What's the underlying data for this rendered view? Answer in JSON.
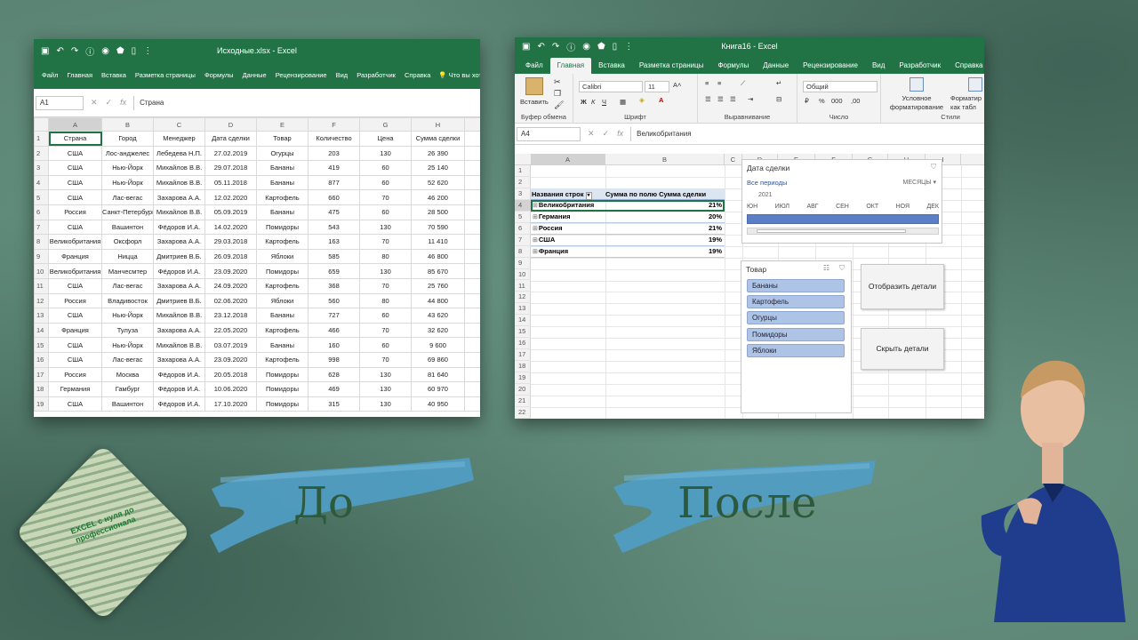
{
  "left_window": {
    "title": "Исходные.xlsx - Excel",
    "menu": [
      "Файл",
      "Главная",
      "Вставка",
      "Разметка страницы",
      "Формулы",
      "Данные",
      "Рецензирование",
      "Вид",
      "Разработчик",
      "Справка"
    ],
    "tell_me": "Что вы хотите сделать?",
    "name_box": "A1",
    "formula": "Страна",
    "columns": [
      "A",
      "B",
      "C",
      "D",
      "E",
      "F",
      "G",
      "H"
    ],
    "rows": [
      [
        "Страна",
        "Город",
        "Менеджер",
        "Дата сделки",
        "Товар",
        "Количество",
        "Цена",
        "Сумма сделки"
      ],
      [
        "США",
        "Лос-анджелес",
        "Лебедева Н.П.",
        "27.02.2019",
        "Огурцы",
        "203",
        "130",
        "26 390"
      ],
      [
        "США",
        "Нью-Йорк",
        "Михайлов В.В.",
        "29.07.2018",
        "Бананы",
        "419",
        "60",
        "25 140"
      ],
      [
        "США",
        "Нью-Йорк",
        "Михайлов В.В.",
        "05.11.2018",
        "Бананы",
        "877",
        "60",
        "52 620"
      ],
      [
        "США",
        "Лас-вегас",
        "Захарова А.А.",
        "12.02.2020",
        "Картофель",
        "660",
        "70",
        "46 200"
      ],
      [
        "Россия",
        "Санкт-Петербург",
        "Михайлов В.В.",
        "05.09.2019",
        "Бананы",
        "475",
        "60",
        "28 500"
      ],
      [
        "США",
        "Вашинтон",
        "Фёдоров И.А.",
        "14.02.2020",
        "Помидоры",
        "543",
        "130",
        "70 590"
      ],
      [
        "Великобритания",
        "Оксфорл",
        "Захарова А.А.",
        "29.03.2018",
        "Картофель",
        "163",
        "70",
        "11 410"
      ],
      [
        "Франция",
        "Ницца",
        "Дмитриев В.Б.",
        "26.09.2018",
        "Яблоки",
        "585",
        "80",
        "46 800"
      ],
      [
        "Великобритания",
        "Манчесмтер",
        "Фёдоров И.А.",
        "23.09.2020",
        "Помидоры",
        "659",
        "130",
        "85 670"
      ],
      [
        "США",
        "Лас-вегас",
        "Захарова А.А.",
        "24.09.2020",
        "Картофель",
        "368",
        "70",
        "25 760"
      ],
      [
        "Россия",
        "Владивосток",
        "Дмитриев В.Б.",
        "02.06.2020",
        "Яблоки",
        "560",
        "80",
        "44 800"
      ],
      [
        "США",
        "Нью-Йорк",
        "Михайлов В.В.",
        "23.12.2018",
        "Бананы",
        "727",
        "60",
        "43 620"
      ],
      [
        "Франция",
        "Тулуза",
        "Захарова А.А.",
        "22.05.2020",
        "Картофель",
        "466",
        "70",
        "32 620"
      ],
      [
        "США",
        "Нью-Йорк",
        "Михайлов В.В.",
        "03.07.2019",
        "Бананы",
        "160",
        "60",
        "9 600"
      ],
      [
        "США",
        "Лас-вегас",
        "Захарова А.А.",
        "23.09.2020",
        "Картофель",
        "998",
        "70",
        "69 860"
      ],
      [
        "Россия",
        "Москва",
        "Фёдоров И.А.",
        "20.05.2018",
        "Помидоры",
        "628",
        "130",
        "81 640"
      ],
      [
        "Германия",
        "Гамбург",
        "Фёдоров И.А.",
        "10.06.2020",
        "Помидоры",
        "469",
        "130",
        "60 970"
      ],
      [
        "США",
        "Вашинтон",
        "Фёдоров И.А.",
        "17.10.2020",
        "Помидоры",
        "315",
        "130",
        "40 950"
      ]
    ]
  },
  "right_window": {
    "title": "Книга16 - Excel",
    "menu": [
      "Файл",
      "Главная",
      "Вставка",
      "Разметка страницы",
      "Формулы",
      "Данные",
      "Рецензирование",
      "Вид",
      "Разработчик",
      "Справка"
    ],
    "active_tab": "Главная",
    "ribbon": {
      "paste": "Вставить",
      "clipboard": "Буфер обмена",
      "font_name": "Calibri",
      "font_size": "11",
      "font_group": "Шрифт",
      "align_group": "Выравнивание",
      "number_format": "Общий",
      "number_group": "Число",
      "cond_format": "Условное форматирование",
      "format_table": "Форматир как табл",
      "styles_group": "Стили"
    },
    "name_box": "A4",
    "formula": "Великобритания",
    "columns": [
      "A",
      "B",
      "C",
      "D",
      "E",
      "F",
      "G",
      "H",
      "I"
    ],
    "row_numbers": [
      "1",
      "2",
      "3",
      "4",
      "5",
      "6",
      "7",
      "8",
      "9",
      "10",
      "11",
      "12",
      "13",
      "14",
      "15",
      "16",
      "17",
      "18",
      "19",
      "20",
      "21",
      "22"
    ],
    "pivot": {
      "header_rows": "Названия строк",
      "header_values": "Сумма по полю Сумма сделки",
      "rows": [
        {
          "label": "Великобритания",
          "value": "21%"
        },
        {
          "label": "Германия",
          "value": "20%"
        },
        {
          "label": "Россия",
          "value": "21%"
        },
        {
          "label": "США",
          "value": "19%"
        },
        {
          "label": "Франция",
          "value": "19%"
        }
      ]
    },
    "timeline": {
      "title": "Дата сделки",
      "all_periods": "Все периоды",
      "level": "МЕСЯЦЫ",
      "year": "2021",
      "months": [
        "ЮН",
        "ИЮЛ",
        "АВГ",
        "СЕН",
        "ОКТ",
        "НОЯ",
        "ДЕК"
      ]
    },
    "slicer": {
      "title": "Товар",
      "items": [
        "Бананы",
        "Картофель",
        "Огурцы",
        "Помидоры",
        "Яблоки"
      ]
    },
    "buttons": {
      "show": "Отобразить детали",
      "hide": "Скрыть детали"
    }
  },
  "labels": {
    "before": "До",
    "after": "После"
  },
  "logo_text": "EXCEL с нуля до профессионала",
  "colors": {
    "excel_green": "#217346",
    "stroke_blue": "#4f9dc4",
    "text_green": "#2d5a3c",
    "slicer_item": "#aec4e6"
  }
}
